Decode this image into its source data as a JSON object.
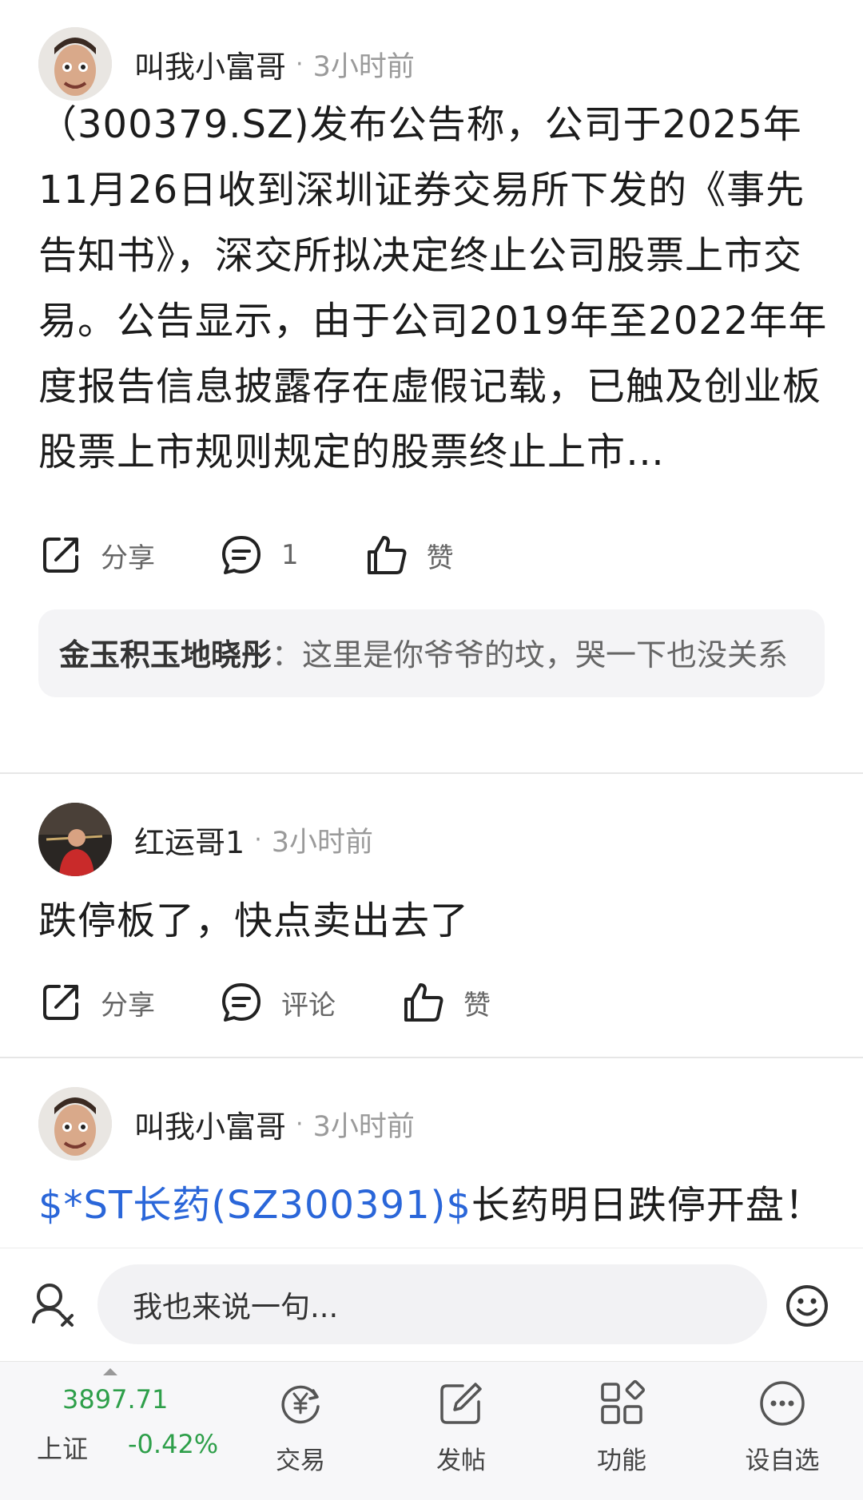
{
  "posts": [
    {
      "author": "叫我小富哥",
      "time": "3小时前",
      "body": "（300379.SZ)发布公告称，公司于2025年11月26日收到深圳证券交易所下发的《事先告知书》，深交所拟决定终止公司股票上市交易。公告显示，由于公司2019年至2022年年度报告信息披露存在虚假记载，已触及创业板股票上市规则规定的股票终止上市…",
      "actions": {
        "share": "分享",
        "comment": "1",
        "like": "赞"
      },
      "comment": {
        "user": "金玉积玉地晓彤",
        "sep": "：",
        "text": "这里是你爷爷的坟，哭一下也没关系"
      }
    },
    {
      "author": "红运哥1",
      "time": "3小时前",
      "body": "跌停板了，快点卖出去了",
      "actions": {
        "share": "分享",
        "comment": "评论",
        "like": "赞"
      }
    },
    {
      "author": "叫我小富哥",
      "time": "3小时前",
      "stock_link": "$*ST长药(SZ300391)$",
      "body": "长药明日跌停开盘！"
    }
  ],
  "input": {
    "placeholder": "我也来说一句..."
  },
  "index": {
    "value": "3897.71",
    "name": "上证",
    "change": "-0.42%"
  },
  "nav": [
    {
      "label": "交易",
      "icon": "trade-yen-icon"
    },
    {
      "label": "发帖",
      "icon": "compose-icon"
    },
    {
      "label": "功能",
      "icon": "grid-apps-icon"
    },
    {
      "label": "设自选",
      "icon": "more-dots-icon"
    }
  ],
  "colors": {
    "link": "#2a66d9",
    "index_green": "#2e9f4a",
    "muted": "#9a9a9a"
  }
}
